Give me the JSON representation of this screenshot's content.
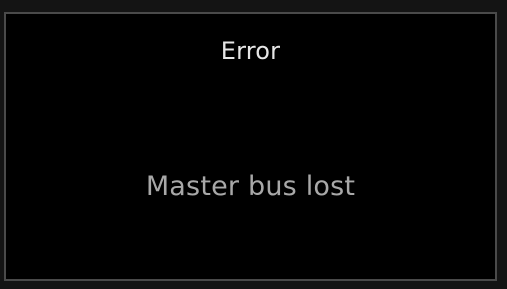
{
  "dialog": {
    "title": "Error",
    "message": "Master bus lost"
  },
  "colors": {
    "background": "#000000",
    "border": "#4a4a4a",
    "title_text": "#e6e6e6",
    "message_text": "#a8a8a8"
  }
}
